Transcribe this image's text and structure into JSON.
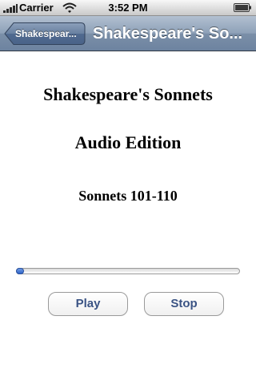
{
  "status_bar": {
    "carrier": "Carrier",
    "time": "3:52 PM",
    "signal_icon": "signal-bars-icon",
    "wifi_icon": "wifi-icon",
    "battery_icon": "battery-icon"
  },
  "nav": {
    "back_label": "Shakespear...",
    "title": "Shakespeare's So..."
  },
  "content": {
    "title": "Shakespeare's Sonnets",
    "edition": "Audio Edition",
    "range": "Sonnets 101-110"
  },
  "player": {
    "progress": 0.02,
    "play_label": "Play",
    "stop_label": "Stop"
  },
  "colors": {
    "nav_bar": "#7b8fa8",
    "button_text": "#3a5384",
    "slider_fill": "#2d63c8"
  }
}
